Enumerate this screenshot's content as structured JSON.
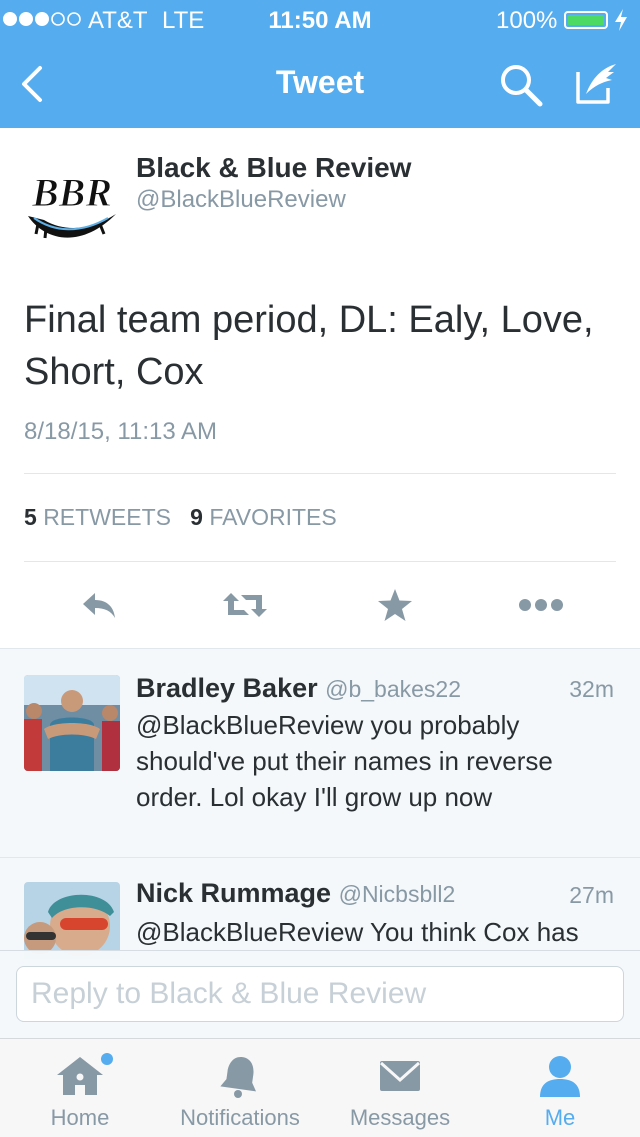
{
  "status_bar": {
    "carrier": "AT&T",
    "network": "LTE",
    "time": "11:50 AM",
    "battery": "100%",
    "battery_level": 1.0,
    "signal_bars": 3,
    "signal_total": 5
  },
  "nav": {
    "title": "Tweet",
    "back_icon": "chevron-left-icon",
    "search_icon": "search-icon",
    "compose_icon": "compose-icon"
  },
  "tweet": {
    "author_name": "Black & Blue Review",
    "author_handle": "@BlackBlueReview",
    "avatar_logo": "BBR",
    "text": "Final team period, DL: Ealy, Love, Short, Cox",
    "date": "8/18/15, 11:13 AM",
    "retweet_count": "5",
    "retweet_label": "RETWEETS",
    "favorite_count": "9",
    "favorite_label": "FAVORITES"
  },
  "actions": {
    "reply_icon": "reply-icon",
    "retweet_icon": "retweet-icon",
    "favorite_icon": "star-icon",
    "more_icon": "more-icon"
  },
  "replies": [
    {
      "name": "Bradley Baker",
      "handle": "@b_bakes22",
      "time": "32m",
      "text": "@BlackBlueReview you probably should've put their names in reverse order. Lol okay I'll grow up now"
    },
    {
      "name": "Nick Rummage",
      "handle": "@Nicbsbll2",
      "time": "27m",
      "text": "@BlackBlueReview You think Cox has"
    }
  ],
  "composer": {
    "placeholder": "Reply to Black & Blue Review"
  },
  "tabs": [
    {
      "label": "Home",
      "icon": "home-icon",
      "active": false,
      "badge": true
    },
    {
      "label": "Notifications",
      "icon": "bell-icon",
      "active": false
    },
    {
      "label": "Messages",
      "icon": "envelope-icon",
      "active": false
    },
    {
      "label": "Me",
      "icon": "person-icon",
      "active": true
    }
  ],
  "colors": {
    "brand": "#55acee",
    "text": "#292f33",
    "muted": "#8899a6",
    "battery": "#4cd964"
  }
}
